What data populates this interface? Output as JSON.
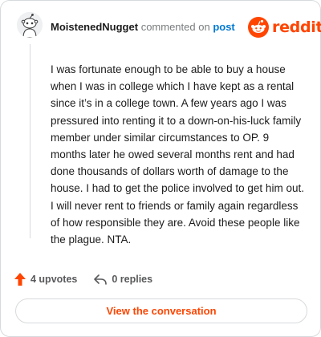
{
  "brand": {
    "name": "reddit",
    "color": "#ff4500",
    "icon": "reddit-snoo-icon"
  },
  "comment": {
    "author": "MoistenedNugget",
    "action_text": "commented on",
    "target_link": "post",
    "avatar_icon": "user-avatar",
    "body": "I was fortunate enough to be able to buy a house when I was in college which I have kept as a rental since it’s in a college town. A few years ago I was pressured into renting it to a down-on-his-luck family member under similar circumstances to OP. 9 months later he owed several months rent and had done thousands of dollars worth of damage to the house. I had to get the police involved to get him out. I will never rent to friends or family again regardless of how responsible they are. Avoid these people like the plague. NTA."
  },
  "actions": {
    "upvotes_label": "4 upvotes",
    "upvote_icon": "upvote-arrow-icon",
    "upvote_color": "#ff4500",
    "replies_label": "0 replies",
    "reply_icon": "reply-arrow-icon"
  },
  "footer": {
    "view_button_label": "View the conversation"
  }
}
